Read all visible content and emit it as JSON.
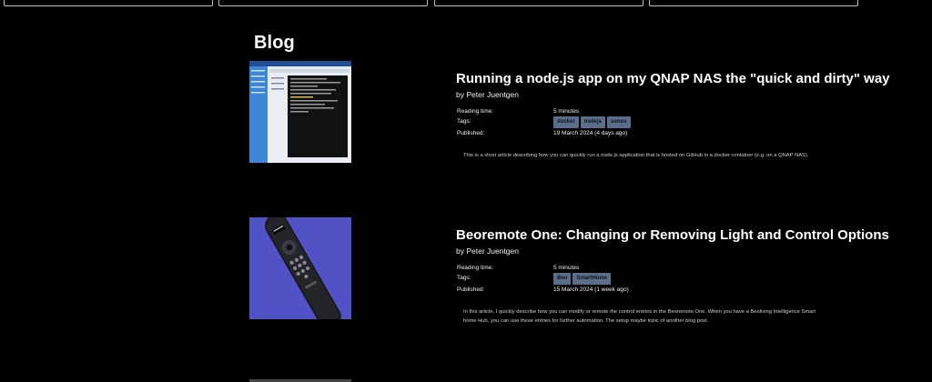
{
  "blog": {
    "heading": "Blog"
  },
  "posts": [
    {
      "title": "Running a node.js app on my QNAP NAS the \"quick and dirty\" way",
      "byline": "by Peter Juentgen",
      "reading_time_label": "Reading time:",
      "reading_time": "5 minutes",
      "tags_label": "Tags:",
      "tags": [
        "docker",
        "nodejs",
        "sonos"
      ],
      "published_label": "Published:",
      "published": "19 March 2024 (4 days ago)",
      "summary": "This is a short article describing how you can quickly run a node.js application that is hosted on GitHub in a docker container (e.g. on a QNAP NAS)."
    },
    {
      "title": "Beoremote One: Changing or Removing Light and Control Options",
      "byline": "by Peter Juentgen",
      "reading_time_label": "Reading time:",
      "reading_time": "5 minutes",
      "tags_label": "Tags:",
      "tags": [
        "Beo",
        "SmartHome"
      ],
      "published_label": "Published:",
      "published": "15 March 2024 (1 week ago)",
      "summary": "In this article, I quickly describe how you can modify or remote the control entries in the Beoremote One. When you have a Beoliving Intelligence Smart home Hub, you can use these entries for further automation. The setup maybe topic of another blog post."
    }
  ],
  "colors": {
    "background": "#000000",
    "tag_bg": "#5a6e8c",
    "thumb2_bg": "#5557c9"
  }
}
